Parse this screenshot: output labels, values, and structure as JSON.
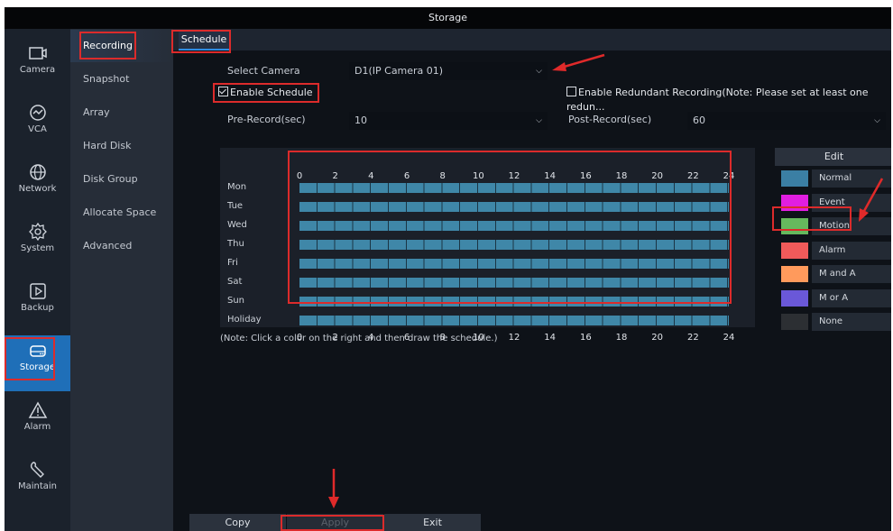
{
  "window": {
    "title": "Storage"
  },
  "rail": {
    "items": [
      {
        "label": "Camera",
        "icon": "camera-icon"
      },
      {
        "label": "VCA",
        "icon": "vca-icon"
      },
      {
        "label": "Network",
        "icon": "globe-icon"
      },
      {
        "label": "System",
        "icon": "gear-icon"
      },
      {
        "label": "Backup",
        "icon": "backup-icon"
      },
      {
        "label": "Storage",
        "icon": "storage-icon",
        "active": true
      },
      {
        "label": "Alarm",
        "icon": "alarm-icon"
      },
      {
        "label": "Maintain",
        "icon": "wrench-icon"
      }
    ]
  },
  "submenu": {
    "items": [
      {
        "label": "Recording",
        "active": true
      },
      {
        "label": "Snapshot"
      },
      {
        "label": "Array"
      },
      {
        "label": "Hard Disk"
      },
      {
        "label": "Disk Group"
      },
      {
        "label": "Allocate Space"
      },
      {
        "label": "Advanced"
      }
    ]
  },
  "tabs": {
    "schedule": "Schedule"
  },
  "form": {
    "select_camera_label": "Select Camera",
    "select_camera_value": "D1(IP Camera 01)",
    "enable_schedule_label": "Enable Schedule",
    "enable_schedule_checked": true,
    "redundant_label": "Enable Redundant Recording(Note: Please set at least one redun...",
    "redundant_checked": false,
    "pre_record_label": "Pre-Record(sec)",
    "pre_record_value": "10",
    "post_record_label": "Post-Record(sec)",
    "post_record_value": "60"
  },
  "schedule": {
    "hour_ticks": [
      "0",
      "2",
      "4",
      "6",
      "8",
      "10",
      "12",
      "14",
      "16",
      "18",
      "20",
      "22",
      "24"
    ],
    "days": [
      "Mon",
      "Tue",
      "Wed",
      "Thu",
      "Fri",
      "Sat",
      "Sun",
      "Holiday"
    ],
    "fill_type": "Normal",
    "fill_color": "#3f87a8",
    "note": "(Note: Click a color on the right and then draw the schedule.)"
  },
  "legend": {
    "edit_label": "Edit",
    "items": [
      {
        "label": "Normal",
        "color": "#3b7fa4"
      },
      {
        "label": "Event",
        "color": "#e11ee1"
      },
      {
        "label": "Motion",
        "color": "#66b95d"
      },
      {
        "label": "Alarm",
        "color": "#f05a5a"
      },
      {
        "label": "M and A",
        "color": "#ff9a5c"
      },
      {
        "label": "M or A",
        "color": "#6a58d8"
      },
      {
        "label": "None",
        "color": "#2c2f33"
      }
    ]
  },
  "buttons": {
    "copy": "Copy",
    "apply": "Apply",
    "exit": "Exit"
  },
  "colors": {
    "accent": "#1f6fb8",
    "highlight": "#dc2b2b",
    "background": "#10141c"
  }
}
